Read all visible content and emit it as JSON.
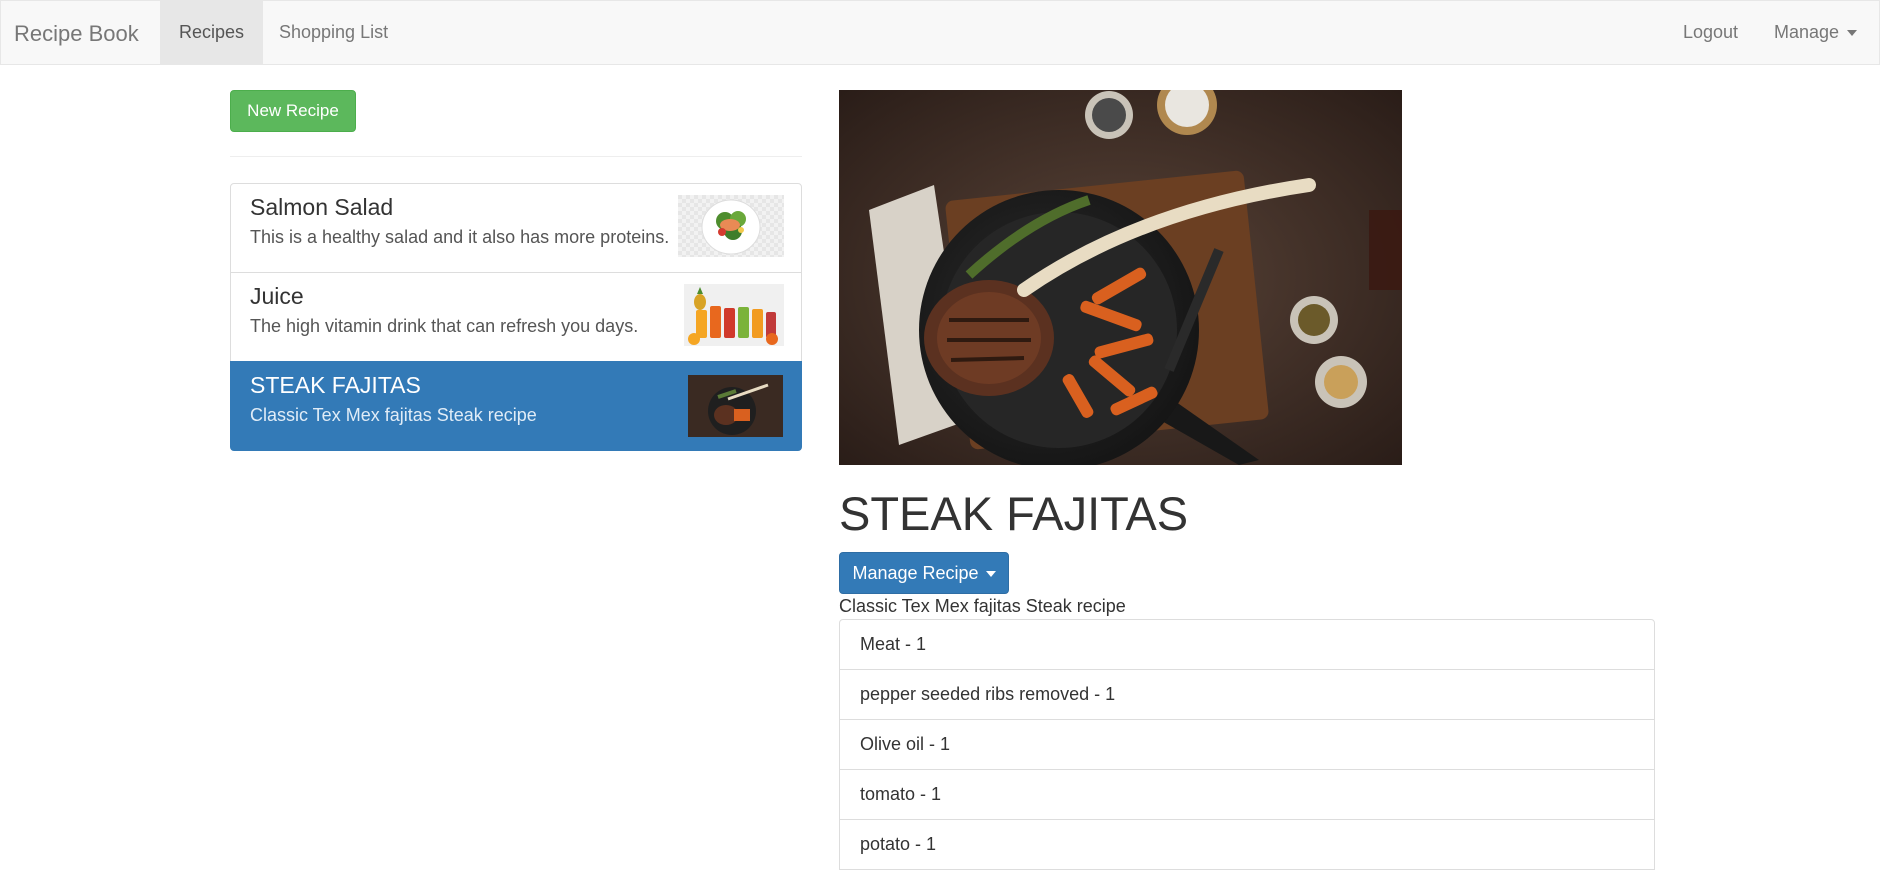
{
  "navbar": {
    "brand": "Recipe Book",
    "tabs": [
      {
        "label": "Recipes",
        "active": true
      },
      {
        "label": "Shopping List",
        "active": false
      }
    ],
    "logout_label": "Logout",
    "manage_label": "Manage"
  },
  "sidebar": {
    "new_recipe_label": "New Recipe",
    "recipes": [
      {
        "name": "Salmon Salad",
        "description": "This is a healthy salad and it also has more proteins."
      },
      {
        "name": "Juice",
        "description": "The high vitamin drink that can refresh you days."
      },
      {
        "name": "STEAK FAJITAS",
        "description": "Classic Tex Mex fajitas Steak recipe",
        "selected": true
      }
    ]
  },
  "detail": {
    "title": "STEAK FAJITAS",
    "manage_recipe_label": "Manage Recipe",
    "description": "Classic Tex Mex fajitas Steak recipe",
    "ingredients": [
      {
        "text": "Meat - 1"
      },
      {
        "text": "pepper seeded ribs removed - 1"
      },
      {
        "text": "Olive oil - 1"
      },
      {
        "text": "tomato - 1"
      },
      {
        "text": "potato - 1"
      }
    ]
  },
  "colors": {
    "primary": "#337ab7",
    "success": "#5cb85c",
    "navbar_bg": "#f8f8f8"
  }
}
